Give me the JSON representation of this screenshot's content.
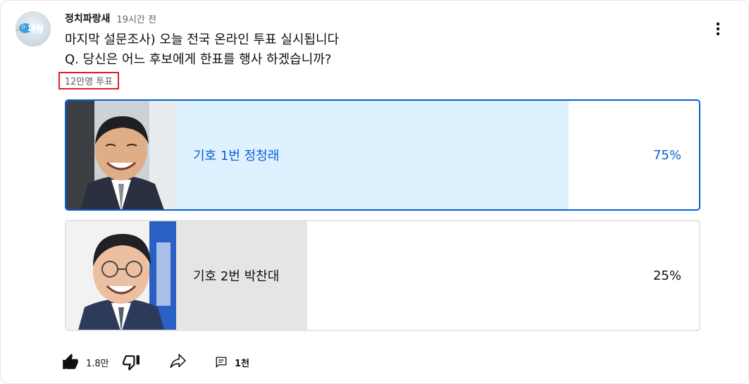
{
  "post": {
    "channel_name": "정치파랑새",
    "time_ago": "19시간 전",
    "avatar_text": "파랑",
    "text_line1": "마지막 설문조사) 오늘 전국 온라인 투표 실시됩니다",
    "text_line2": "Q. 당신은 어느 후보에게 한표를 행사 하겠습니까?",
    "menu_icon": "more-vert-icon"
  },
  "poll": {
    "total_votes": "12만명 투표",
    "options": [
      {
        "label": "기호 1번 정청래",
        "percent": "75%",
        "fill_fraction": 0.75,
        "selected": true
      },
      {
        "label": "기호 2번 박찬대",
        "percent": "25%",
        "fill_fraction": 0.25,
        "selected": false
      }
    ]
  },
  "actions": {
    "like_icon": "thumb-up-icon",
    "like_count": "1.8만",
    "dislike_icon": "thumb-down-icon",
    "share_icon": "share-icon",
    "comment_icon": "comment-icon",
    "comment_count": "1천"
  },
  "colors": {
    "accent": "#065fd4",
    "selected_fill": "#def1ff",
    "unselected_fill": "#e5e5e5",
    "highlight_box": "#e01e1e"
  }
}
